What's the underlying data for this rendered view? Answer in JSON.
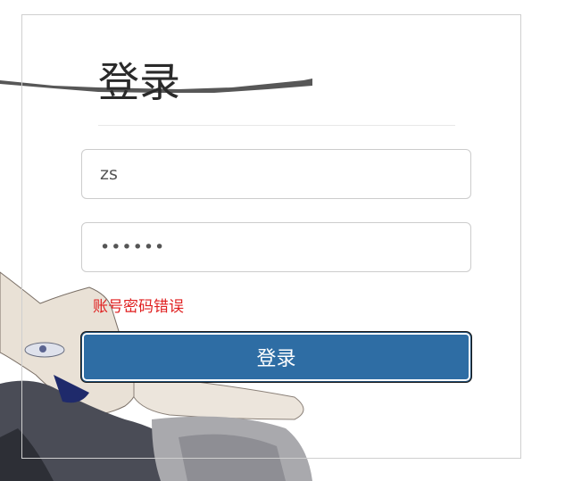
{
  "login": {
    "title": "登录",
    "username_value": "zs",
    "password_value": "••••••",
    "error_message": "账号密码错误",
    "submit_label": "登录"
  },
  "colors": {
    "primary_button": "#2e6da4",
    "error_text": "#e02020",
    "panel_border": "#cfcfcf"
  }
}
